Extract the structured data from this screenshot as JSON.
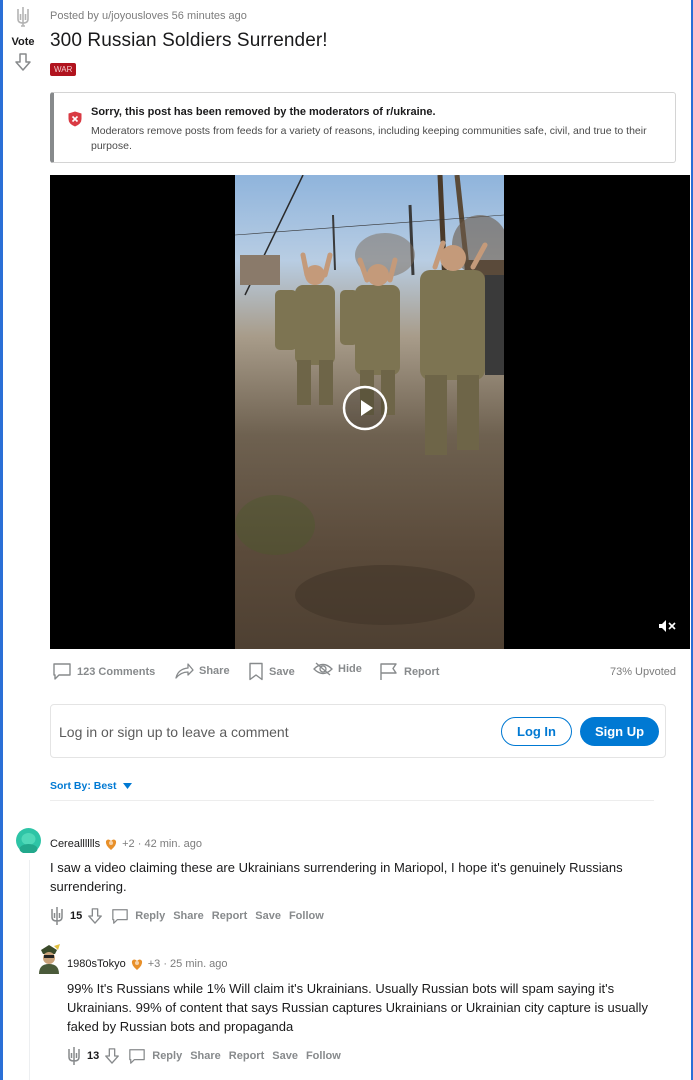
{
  "post": {
    "vote_label": "Vote",
    "meta": "Posted by u/joyousloves 56 minutes ago",
    "title": "300 Russian Soldiers Surrender!",
    "flair": "WAR",
    "removed_title": "Sorry, this post has been removed by the moderators of r/ukraine.",
    "removed_text": "Moderators remove posts from feeds for a variety of reasons, including keeping communities safe, civil, and true to their purpose."
  },
  "actions": {
    "comments": "123 Comments",
    "share": "Share",
    "save": "Save",
    "hide": "Hide",
    "report": "Report",
    "upvoted": "73% Upvoted"
  },
  "login": {
    "prompt": "Log in or sign up to leave a comment",
    "login_label": "Log In",
    "signup_label": "Sign Up"
  },
  "sort": {
    "label": "Sort By: Best"
  },
  "comments": [
    {
      "user": "Cerealllllls",
      "karma": "+2",
      "time": "· 42 min. ago",
      "body": "I saw a video claiming these are Ukrainians surrendering in Mariopol, I hope it's genuinely Russians surrendering.",
      "score": "15",
      "reply": "Reply",
      "share": "Share",
      "report": "Report",
      "save": "Save",
      "follow": "Follow",
      "avatar_color": "#2ec4a6"
    },
    {
      "user": "1980sTokyo",
      "karma": "+3",
      "time": "· 25 min. ago",
      "body": "99% It's Russians while 1% Will claim it's Ukrainians. Usually Russian bots will spam saying it's Ukrainians. 99% of content that says Russian captures Ukrainians or Ukrainian city capture is usually faked by Russian bots and propaganda",
      "score": "13",
      "reply": "Reply",
      "share": "Share",
      "report": "Report",
      "save": "Save",
      "follow": "Follow",
      "avatar_color": "#4a5a3a"
    }
  ],
  "colors": {
    "accent": "#0079d3",
    "flair_bg": "#b1131e",
    "removed_icon": "#d93a43",
    "frame": "#2a6fd6"
  },
  "icons": [
    "trident-icon",
    "downvote-icon",
    "shield-x-icon",
    "play-icon",
    "mute-icon",
    "comment-icon",
    "share-icon",
    "save-icon",
    "hide-icon",
    "report-icon",
    "caret-down-icon",
    "award-icon"
  ]
}
